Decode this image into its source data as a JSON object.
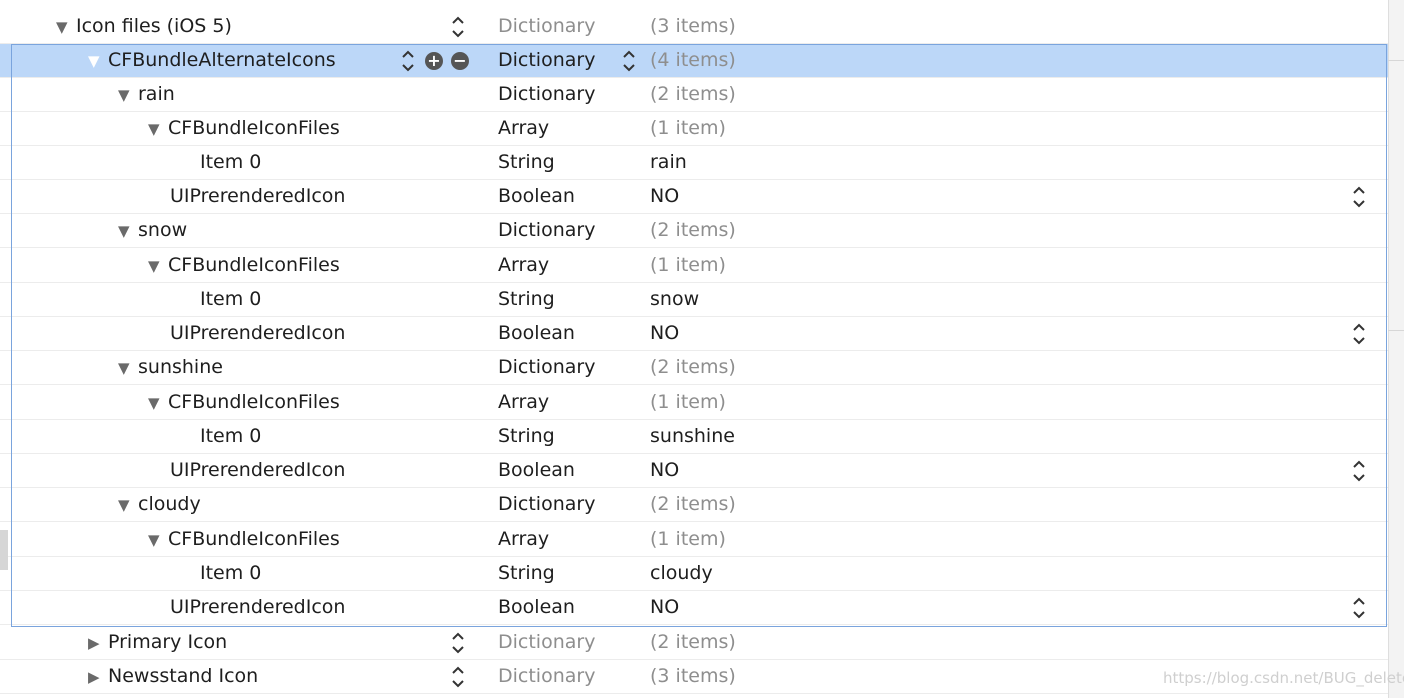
{
  "rows": [
    {
      "key": "Icon files (iOS 5)",
      "type": "Dictionary",
      "value": "(3 items)",
      "key_gray": false,
      "type_gray": true,
      "value_gray": true
    },
    {
      "key": "CFBundleAlternateIcons",
      "type": "Dictionary",
      "value": "(4 items)",
      "key_gray": false,
      "type_gray": false,
      "value_gray": true
    },
    {
      "key": "rain",
      "type": "Dictionary",
      "value": "(2 items)",
      "key_gray": false,
      "type_gray": false,
      "value_gray": true
    },
    {
      "key": "CFBundleIconFiles",
      "type": "Array",
      "value": "(1 item)",
      "key_gray": false,
      "type_gray": false,
      "value_gray": true
    },
    {
      "key": "Item 0",
      "type": "String",
      "value": "rain",
      "key_gray": false,
      "type_gray": false,
      "value_gray": false
    },
    {
      "key": "UIPrerenderedIcon",
      "type": "Boolean",
      "value": "NO",
      "key_gray": false,
      "type_gray": false,
      "value_gray": false
    },
    {
      "key": "snow",
      "type": "Dictionary",
      "value": "(2 items)",
      "key_gray": false,
      "type_gray": false,
      "value_gray": true
    },
    {
      "key": "CFBundleIconFiles",
      "type": "Array",
      "value": "(1 item)",
      "key_gray": false,
      "type_gray": false,
      "value_gray": true
    },
    {
      "key": "Item 0",
      "type": "String",
      "value": "snow",
      "key_gray": false,
      "type_gray": false,
      "value_gray": false
    },
    {
      "key": "UIPrerenderedIcon",
      "type": "Boolean",
      "value": "NO",
      "key_gray": false,
      "type_gray": false,
      "value_gray": false
    },
    {
      "key": "sunshine",
      "type": "Dictionary",
      "value": "(2 items)",
      "key_gray": false,
      "type_gray": false,
      "value_gray": true
    },
    {
      "key": "CFBundleIconFiles",
      "type": "Array",
      "value": "(1 item)",
      "key_gray": false,
      "type_gray": false,
      "value_gray": true
    },
    {
      "key": "Item 0",
      "type": "String",
      "value": "sunshine",
      "key_gray": false,
      "type_gray": false,
      "value_gray": false
    },
    {
      "key": "UIPrerenderedIcon",
      "type": "Boolean",
      "value": "NO",
      "key_gray": false,
      "type_gray": false,
      "value_gray": false
    },
    {
      "key": "cloudy",
      "type": "Dictionary",
      "value": "(2 items)",
      "key_gray": false,
      "type_gray": false,
      "value_gray": true
    },
    {
      "key": "CFBundleIconFiles",
      "type": "Array",
      "value": "(1 item)",
      "key_gray": false,
      "type_gray": false,
      "value_gray": true
    },
    {
      "key": "Item 0",
      "type": "String",
      "value": "cloudy",
      "key_gray": false,
      "type_gray": false,
      "value_gray": false
    },
    {
      "key": "UIPrerenderedIcon",
      "type": "Boolean",
      "value": "NO",
      "key_gray": false,
      "type_gray": false,
      "value_gray": false
    },
    {
      "key": "Primary Icon",
      "type": "Dictionary",
      "value": "(2 items)",
      "key_gray": false,
      "type_gray": true,
      "value_gray": true
    },
    {
      "key": "Newsstand Icon",
      "type": "Dictionary",
      "value": "(3 items)",
      "key_gray": false,
      "type_gray": true,
      "value_gray": true
    }
  ],
  "watermark": "https://blog.csdn.net/BUG_delete",
  "colors": {
    "selection": "#bcd7f8",
    "group_border": "#7aa4dd",
    "secondary_text": "#8e8e8e"
  },
  "icons": {
    "expanded": "disclosure-triangle-down-icon",
    "collapsed": "disclosure-triangle-right-icon",
    "stepper": "up-down-chevron-icon",
    "add": "plus-circle-icon",
    "remove": "minus-circle-icon"
  }
}
